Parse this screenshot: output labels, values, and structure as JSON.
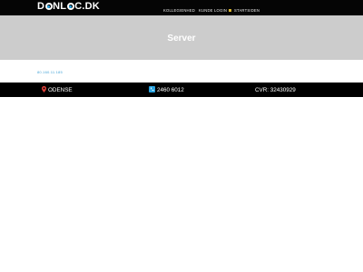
{
  "header": {
    "logo": {
      "part1": "D",
      "part2": "NL",
      "part3": "C.DK"
    },
    "nav": [
      {
        "label": "KOLLEGIENHED"
      },
      {
        "label": "KUNDE LOGIN"
      },
      {
        "label": "STARTSIDEN"
      }
    ]
  },
  "banner": {
    "title": "Server"
  },
  "content": {
    "link_text": "80.160.11.185"
  },
  "footer": {
    "city": "ODENSE",
    "phone": "2460 6012",
    "cvr": "CVR: 32430929"
  },
  "colors": {
    "accent": "#29a3e0",
    "pin": "#e0403a",
    "link": "#4aa6d8",
    "banner": "#cccccc"
  },
  "icons": [
    "ring-o-icon",
    "lock-icon",
    "map-pin-icon",
    "phone-icon"
  ]
}
